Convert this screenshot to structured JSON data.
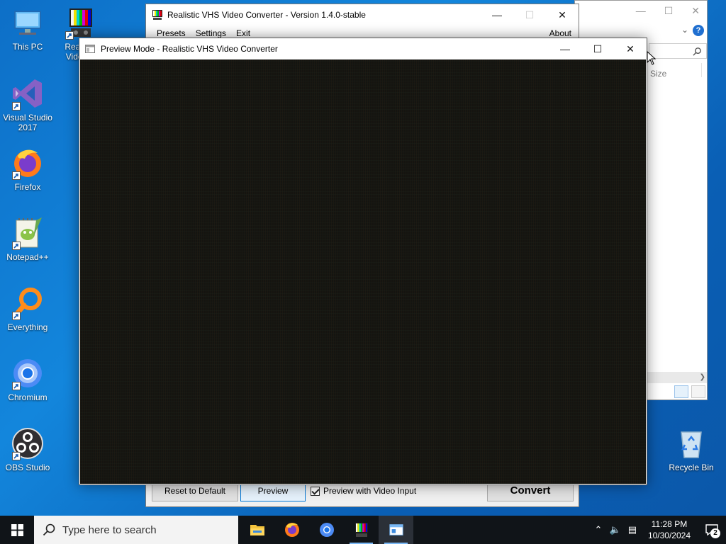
{
  "desktop": {
    "icons": [
      {
        "label": "This PC",
        "icon": "this-pc-icon"
      },
      {
        "label": "Realistic VHS Video Converter",
        "short_label": "Realis… Video…",
        "icon": "vhs-converter-icon"
      },
      {
        "label": "Visual Studio 2017",
        "icon": "visual-studio-icon"
      },
      {
        "label": "Firefox",
        "icon": "firefox-icon"
      },
      {
        "label": "Notepad++",
        "icon": "notepad-plus-plus-icon"
      },
      {
        "label": "Everything",
        "icon": "everything-search-icon"
      },
      {
        "label": "Chromium",
        "icon": "chromium-icon"
      },
      {
        "label": "OBS Studio",
        "icon": "obs-studio-icon"
      },
      {
        "label": "Recycle Bin",
        "icon": "recycle-bin-icon"
      }
    ]
  },
  "explorer": {
    "column_size": "Size"
  },
  "main_window": {
    "title": "Realistic VHS Video Converter - Version 1.4.0-stable",
    "menu": {
      "presets": "Presets",
      "settings": "Settings",
      "exit": "Exit",
      "about": "About"
    },
    "buttons": {
      "reset": "Reset to Default",
      "preview": "Preview",
      "convert": "Convert"
    },
    "preview_with_input": {
      "label": "Preview with Video Input",
      "checked": true
    }
  },
  "preview_window": {
    "title": "Preview Mode - Realistic VHS Video Converter"
  },
  "taskbar": {
    "search_placeholder": "Type here to search",
    "apps": [
      {
        "name": "File Explorer",
        "icon": "file-explorer-icon"
      },
      {
        "name": "Firefox",
        "icon": "firefox-icon"
      },
      {
        "name": "Chromium",
        "icon": "chromium-icon"
      },
      {
        "name": "Realistic VHS Video Converter",
        "icon": "vhs-converter-icon"
      },
      {
        "name": "Preview Mode",
        "icon": "preview-window-icon"
      }
    ],
    "clock": {
      "time": "11:28 PM",
      "date": "10/30/2024"
    },
    "notification_count": "2"
  },
  "colors": {
    "desktop_blue": "#0d6fc7",
    "taskbar": "#101418",
    "focus_border": "#0078d7"
  }
}
